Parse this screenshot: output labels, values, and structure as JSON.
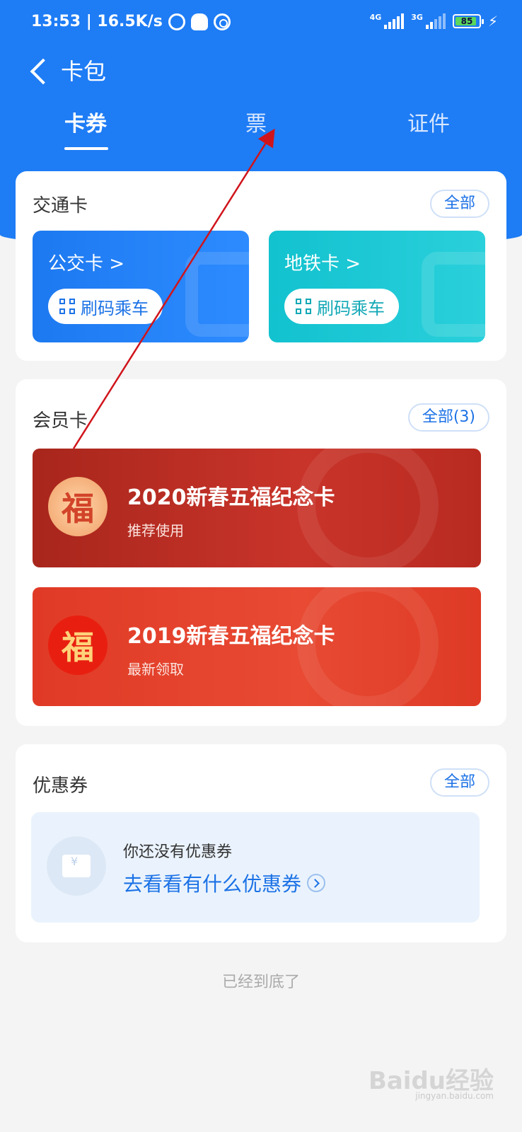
{
  "status_bar": {
    "time_speed": "13:53 | 16.5K/s",
    "net1": "4G",
    "net2": "3G",
    "battery": "85"
  },
  "header": {
    "title": "卡包"
  },
  "tabs": [
    {
      "label": "卡券",
      "active": true
    },
    {
      "label": "票",
      "active": false
    },
    {
      "label": "证件",
      "active": false
    }
  ],
  "transit": {
    "title": "交通卡",
    "all_label": "全部",
    "cards": [
      {
        "name": "公交卡 >",
        "button": "刷码乘车"
      },
      {
        "name": "地铁卡 >",
        "button": "刷码乘车"
      }
    ]
  },
  "membership": {
    "title": "会员卡",
    "all_label": "全部(3)",
    "cards": [
      {
        "badge": "福",
        "name": "2020新春五福纪念卡",
        "subtitle": "推荐使用",
        "color": "#b02a1f"
      },
      {
        "badge": "福",
        "name": "2019新春五福纪念卡",
        "subtitle": "最新领取",
        "color": "#e23d28"
      }
    ]
  },
  "coupons": {
    "title": "优惠券",
    "all_label": "全部",
    "empty_text": "你还没有优惠券",
    "link_text": "去看看有什么优惠券"
  },
  "footer_note": "已经到底了",
  "watermark": {
    "brand": "Baidu经验",
    "url": "jingyan.baidu.com"
  },
  "colors": {
    "primary": "#1e7cf5",
    "metro": "#12c2cf",
    "link": "#1c72e6"
  }
}
